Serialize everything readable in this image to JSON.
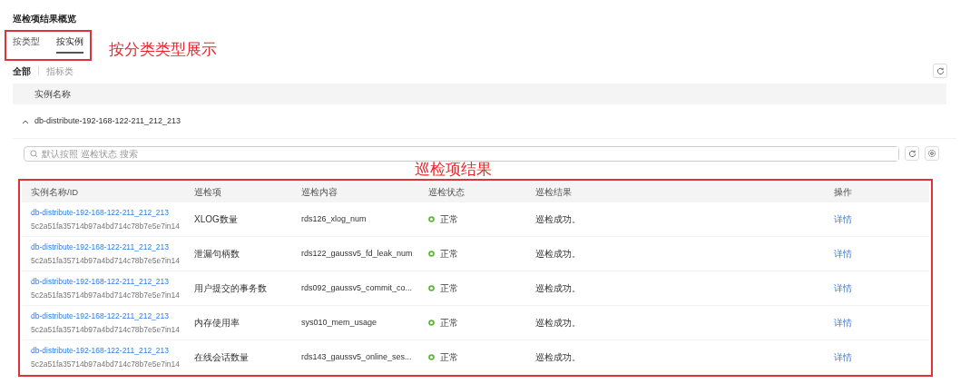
{
  "title": "巡检项结果概览",
  "tabs": [
    {
      "label": "按类型",
      "selected": false
    },
    {
      "label": "按实例",
      "selected": true
    }
  ],
  "filters": [
    {
      "label": "全部",
      "selected": true
    },
    {
      "label": "指标类",
      "selected": false
    }
  ],
  "instance_table": {
    "column": "实例名称",
    "group": {
      "label": "db-distribute-192-168-122-211_212_213",
      "expanded": true
    }
  },
  "search": {
    "placeholder": "默认按照 巡检状态 搜索"
  },
  "table": {
    "columns": [
      "实例名称/ID",
      "巡检项",
      "巡检内容",
      "巡检状态",
      "巡检结果",
      "操作"
    ],
    "rows": [
      {
        "name": "db-distribute-192-168-122-211_212_213",
        "id": "5c2a51fa35714b97a4bd714c78b7e5e7in14",
        "item": "XLOG数量",
        "content": "rds126_xlog_num",
        "status": "正常",
        "result": "巡检成功。",
        "action": "详情"
      },
      {
        "name": "db-distribute-192-168-122-211_212_213",
        "id": "5c2a51fa35714b97a4bd714c78b7e5e7in14",
        "item": "泄漏句柄数",
        "content": "rds122_gaussv5_fd_leak_num",
        "status": "正常",
        "result": "巡检成功。",
        "action": "详情"
      },
      {
        "name": "db-distribute-192-168-122-211_212_213",
        "id": "5c2a51fa35714b97a4bd714c78b7e5e7in14",
        "item": "用户提交的事务数",
        "content": "rds092_gaussv5_commit_co...",
        "status": "正常",
        "result": "巡检成功。",
        "action": "详情"
      },
      {
        "name": "db-distribute-192-168-122-211_212_213",
        "id": "5c2a51fa35714b97a4bd714c78b7e5e7in14",
        "item": "内存使用率",
        "content": "sys010_mem_usage",
        "status": "正常",
        "result": "巡检成功。",
        "action": "详情"
      },
      {
        "name": "db-distribute-192-168-122-211_212_213",
        "id": "5c2a51fa35714b97a4bd714c78b7e5e7in14",
        "item": "在线会话数量",
        "content": "rds143_gaussv5_online_ses...",
        "status": "正常",
        "result": "巡检成功。",
        "action": "详情"
      }
    ]
  },
  "annotations": [
    {
      "kind": "tabs",
      "text": "按分类类型展示"
    },
    {
      "kind": "table",
      "text": "巡检项结果"
    }
  ]
}
